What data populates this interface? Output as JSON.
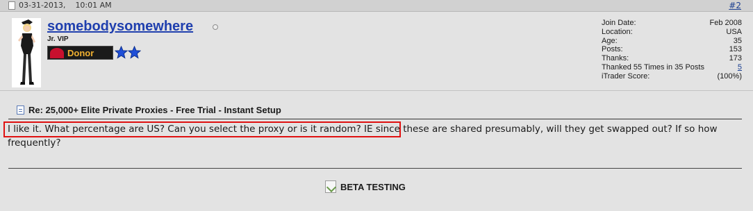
{
  "post_header": {
    "date": "03-31-2013,",
    "time": "10:01 AM",
    "post_number": "#2"
  },
  "user": {
    "username": "somebodysomewhere",
    "title": "Jr. VIP",
    "badge_label": "Donor",
    "status": "offline",
    "star_color": "#1f4fd8"
  },
  "userinfo": [
    {
      "label": "Join Date:",
      "value": "Feb 2008"
    },
    {
      "label": "Location:",
      "value": "USA"
    },
    {
      "label": "Age:",
      "value": "35"
    },
    {
      "label": "Posts:",
      "value": "153"
    },
    {
      "label": "Thanks:",
      "value": "173"
    },
    {
      "label": "Thanked 55 Times in 35 Posts",
      "value": "5"
    },
    {
      "label": "iTrader Score:",
      "value": "(100%)"
    }
  ],
  "post": {
    "title": "Re: 25,000+ Elite Private Proxies - Free Trial - Instant Setup",
    "body": "I like it. What percentage are US? Can you select the proxy or is it random? IE since these are shared presumably, will they get swapped out? If so how frequently?"
  },
  "signature": {
    "text": "BETA TESTING"
  }
}
